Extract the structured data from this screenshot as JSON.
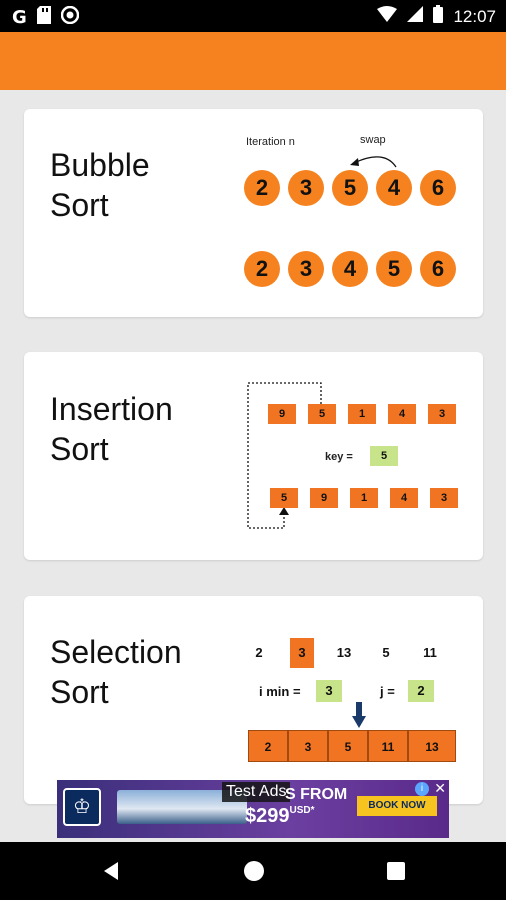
{
  "status_bar": {
    "left_icons": [
      "google-g-icon",
      "sd-card-icon",
      "sync-circle-icon"
    ],
    "g_glyph": "G",
    "time": "12:07"
  },
  "cards": [
    {
      "title_line1": "Bubble",
      "title_line2": "Sort",
      "label_iteration": "Iteration n",
      "label_swap": "swap",
      "row1": [
        "2",
        "3",
        "5",
        "4",
        "6"
      ],
      "row2": [
        "2",
        "3",
        "4",
        "5",
        "6"
      ]
    },
    {
      "title_line1": "Insertion",
      "title_line2": "Sort",
      "row1": [
        "9",
        "5",
        "1",
        "4",
        "3"
      ],
      "key_label": "key =",
      "key_value": "5",
      "row2": [
        "5",
        "9",
        "1",
        "4",
        "3"
      ]
    },
    {
      "title_line1": "Selection",
      "title_line2": "Sort",
      "top_row": [
        "2",
        "3",
        "13",
        "5",
        "11"
      ],
      "imin_label": "i min =",
      "imin_value": "3",
      "j_label": "j =",
      "j_value": "2",
      "bottom_row": [
        "2",
        "3",
        "5",
        "11",
        "13"
      ]
    }
  ],
  "ad": {
    "test_label": "Test Ads",
    "from_text": "S FROM",
    "price": "$299",
    "price_suffix": "USD*",
    "book_now": "BOOK NOW",
    "info": "i",
    "close": "✕"
  },
  "colors": {
    "accent": "#f5821f",
    "box_orange": "#f07421",
    "key_green": "#c8e48a"
  }
}
